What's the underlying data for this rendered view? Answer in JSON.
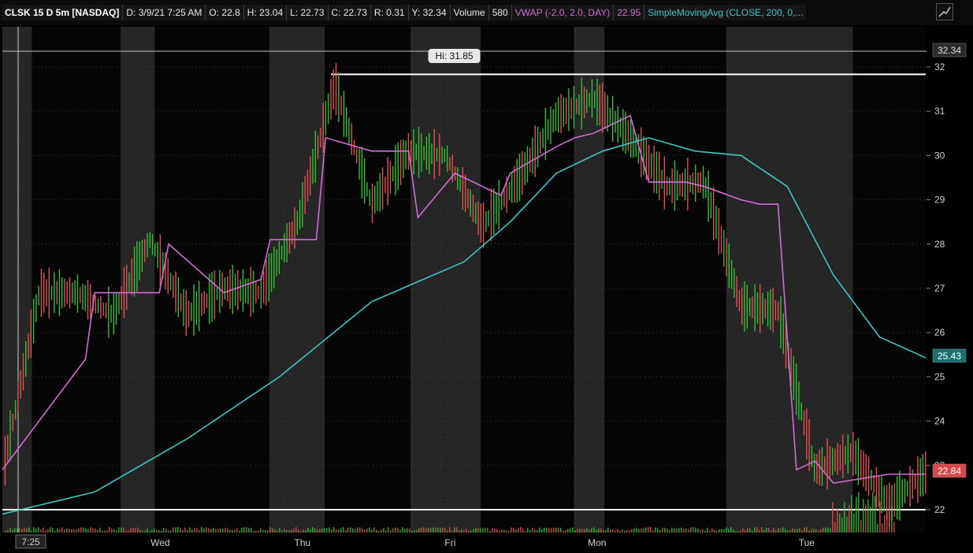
{
  "header": {
    "symbol": "CLSK 15 D 5m [NASDAQ]",
    "date": "D: 3/9/21 7:25 AM",
    "open": "O: 22.8",
    "high": "H: 23.04",
    "low": "L: 22.73",
    "close": "C: 22.73",
    "range": "R: 0.31",
    "y": "Y: 32.34",
    "volume_label": "Volume",
    "volume_value": "580",
    "vwap_label": "VWAP (-2.0, 2.0, DAY)",
    "vwap_value": "22.95",
    "sma_label": "SimpleMovingAvg (CLOSE, 200, 0,..."
  },
  "colors": {
    "vwap": "#d36ad6",
    "sma": "#3cc6c6",
    "up": "#2fbf2f",
    "down": "#e05050",
    "session_shade": "#262626"
  },
  "price_axis": {
    "ticks": [
      "22",
      "23",
      "24",
      "25",
      "26",
      "27",
      "28",
      "29",
      "30",
      "31",
      "32"
    ],
    "high_badge": "32.34",
    "sma_badge": "25.43",
    "last_badge": "22.84"
  },
  "time_axis": {
    "start_label": "7:25",
    "day_labels": [
      "Wed",
      "Thu",
      "Fri",
      "Mon",
      "Tue"
    ]
  },
  "annotations": {
    "hi_callout": "Hi: 31.85"
  },
  "chart_data": {
    "type": "line",
    "ylim": [
      21.5,
      32.5
    ],
    "high_line": 32.34,
    "hi_line": 31.85,
    "support_line": 22.0,
    "series": [
      {
        "name": "Price",
        "x": [
          0,
          4,
          8,
          12,
          16,
          20,
          24,
          28,
          32,
          36,
          40,
          44,
          48,
          52,
          56,
          60,
          64,
          68,
          72,
          76,
          80,
          84,
          88,
          92,
          96,
          100
        ],
        "values": [
          22.8,
          26.9,
          26.9,
          26.4,
          28.1,
          26.4,
          27.0,
          26.9,
          28.5,
          31.6,
          28.9,
          30.1,
          30.0,
          28.4,
          29.5,
          30.9,
          31.3,
          30.4,
          29.3,
          29.4,
          26.6,
          26.5,
          22.9,
          23.3,
          22.1,
          22.84
        ]
      },
      {
        "name": "VWAP",
        "x": [
          0,
          9,
          10,
          17,
          18,
          24,
          28,
          29,
          34,
          35,
          40,
          44,
          45,
          49,
          54,
          55,
          60,
          62,
          64,
          68,
          70,
          74,
          76,
          80,
          82,
          84,
          86,
          88,
          90,
          96,
          100
        ],
        "values": [
          22.9,
          25.4,
          26.9,
          26.9,
          28.0,
          26.9,
          27.2,
          28.1,
          28.1,
          30.4,
          30.1,
          30.1,
          28.6,
          29.6,
          29.1,
          29.6,
          30.2,
          30.4,
          30.5,
          30.9,
          29.4,
          29.4,
          29.3,
          29.0,
          28.9,
          28.9,
          22.9,
          23.1,
          22.6,
          22.8,
          22.8
        ]
      },
      {
        "name": "SMA",
        "x": [
          0,
          10,
          20,
          30,
          40,
          50,
          55,
          60,
          65,
          70,
          75,
          80,
          85,
          90,
          95,
          100
        ],
        "values": [
          21.9,
          22.4,
          23.6,
          25.0,
          26.7,
          27.6,
          28.5,
          29.6,
          30.1,
          30.4,
          30.1,
          30.0,
          29.3,
          27.3,
          25.9,
          25.43
        ]
      }
    ]
  }
}
